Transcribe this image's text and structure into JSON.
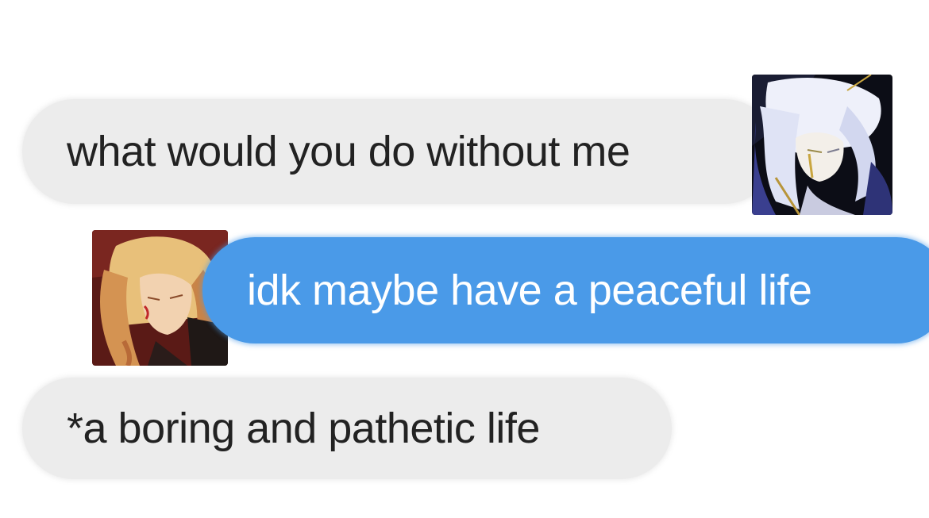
{
  "messages": [
    {
      "sender": "received",
      "text": "what would you do without me",
      "avatar_icon": "white-haired-character-avatar-icon"
    },
    {
      "sender": "sent",
      "text": "idk maybe have a peaceful life",
      "avatar_icon": "blond-haired-character-avatar-icon"
    },
    {
      "sender": "received",
      "text": "*a boring and pathetic life"
    }
  ],
  "colors": {
    "background": "#ffffff",
    "incoming_bubble": "#ececec",
    "incoming_text": "#222222",
    "outgoing_bubble": "#4a9ae8",
    "outgoing_text": "#ffffff"
  }
}
